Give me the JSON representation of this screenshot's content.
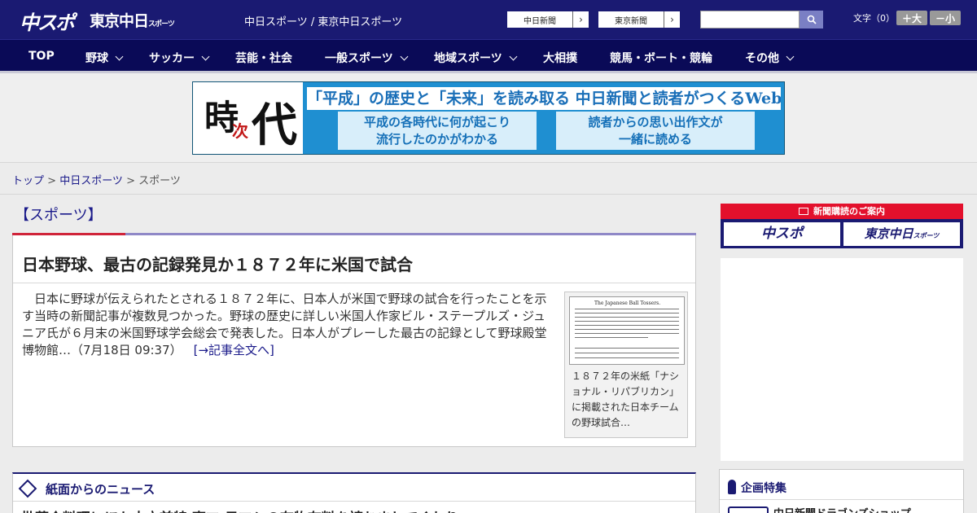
{
  "header": {
    "logo_chunichi": "中スポ",
    "logo_tokyo": "東京中日",
    "logo_tokyo_small": "スポーツ",
    "site_links": "中日スポーツ / 東京中日スポーツ",
    "paper_buttons": [
      "中日新聞",
      "東京新聞"
    ],
    "search_placeholder": "",
    "font_size_label": "文字（0）",
    "font_bigger": "＋大",
    "font_smaller": "－小"
  },
  "nav": {
    "items": [
      "TOP",
      "野球",
      "サッカー",
      "芸能・社会",
      "一般スポーツ",
      "地域スポーツ",
      "大相撲",
      "競馬・ボート・競輪",
      "その他"
    ]
  },
  "banner": {
    "logo_ji": "時",
    "logo_tsugi": "次",
    "logo_dai": "代",
    "headline": "「平成」の歴史と「未来」を読み取る 中日新聞と読者がつくるWebサイト",
    "box1_line1": "平成の各時代に何が起こり",
    "box1_line2": "流行したのかがわかる",
    "box2_line1": "読者からの思い出作文が",
    "box2_line2": "一緒に読める"
  },
  "breadcrumb": {
    "home": "トップ",
    "parent": "中日スポーツ",
    "current": "スポーツ",
    "separator": " > "
  },
  "main": {
    "section_title": "【スポーツ】",
    "article": {
      "title": "日本野球、最古の記録発見か１８７２年に米国で試合",
      "body": "　日本に野球が伝えられたとされる１８７２年に、日本人が米国で野球の試合を行ったことを示す当時の新聞記事が複数見つかった。野球の歴史に詳しい米国人作家ビル・ステープルズ・ジュニア氏が６月末の米国野球学会総会で発表した。日本人がプレーした最古の記録として野球殿堂博物館…（7月18日 09:37）",
      "more_link": "[→記事全文へ]",
      "thumb_headline": "The Japanese Ball Tossers.",
      "thumb_caption": "１８７２年の米紙「ナショナル・リパブリカン」に掲載された日本チームの野球試合…"
    },
    "news_section_title": "紙面からのニュース",
    "news_first_item": "批菜介料理にほか大立首特 東マ 日マシの有物有料を読むましてくれり"
  },
  "sidebar": {
    "subscription_title": "新聞購読のご案内",
    "sub_btn1": "中スポ",
    "sub_btn2": "東京中日",
    "sub_btn2_small": "スポーツ",
    "feature_title": "企画特集",
    "feature_item": "中日新聞ドラゴンズショップ"
  }
}
